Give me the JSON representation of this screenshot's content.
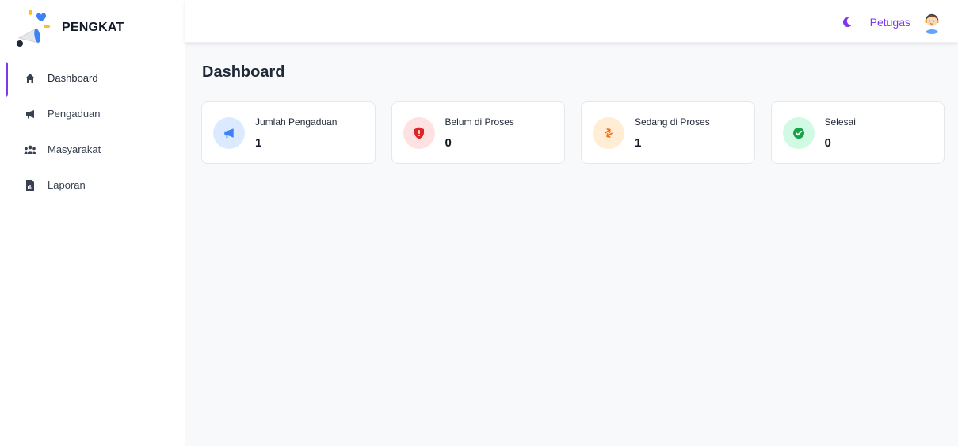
{
  "app": {
    "brand": "PENGKAT"
  },
  "sidebar": {
    "items": [
      {
        "label": "Dashboard",
        "icon": "home-icon",
        "active": true
      },
      {
        "label": "Pengaduan",
        "icon": "megaphone-icon"
      },
      {
        "label": "Masyarakat",
        "icon": "users-icon"
      },
      {
        "label": "Laporan",
        "icon": "report-file-icon"
      }
    ]
  },
  "header": {
    "theme_icon": "moon-icon",
    "user_name": "Petugas",
    "avatar_icon": "user-avatar-icon"
  },
  "main": {
    "title": "Dashboard",
    "cards": [
      {
        "title": "Jumlah Pengaduan",
        "value": "1",
        "icon": "megaphone-icon",
        "accent": "#3b82f6",
        "bg": "#dbeafe"
      },
      {
        "title": "Belum di Proses",
        "value": "0",
        "icon": "shield-alert-icon",
        "accent": "#dc2626",
        "bg": "#fee2e2"
      },
      {
        "title": "Sedang di Proses",
        "value": "1",
        "icon": "exchange-arrows-icon",
        "accent": "#f97316",
        "bg": "#ffedd5"
      },
      {
        "title": "Selesai",
        "value": "0",
        "icon": "check-circle-icon",
        "accent": "#16a34a",
        "bg": "#d1fae5"
      }
    ]
  },
  "colors": {
    "primary": "#7c3aed",
    "background": "#f8f9fb"
  }
}
